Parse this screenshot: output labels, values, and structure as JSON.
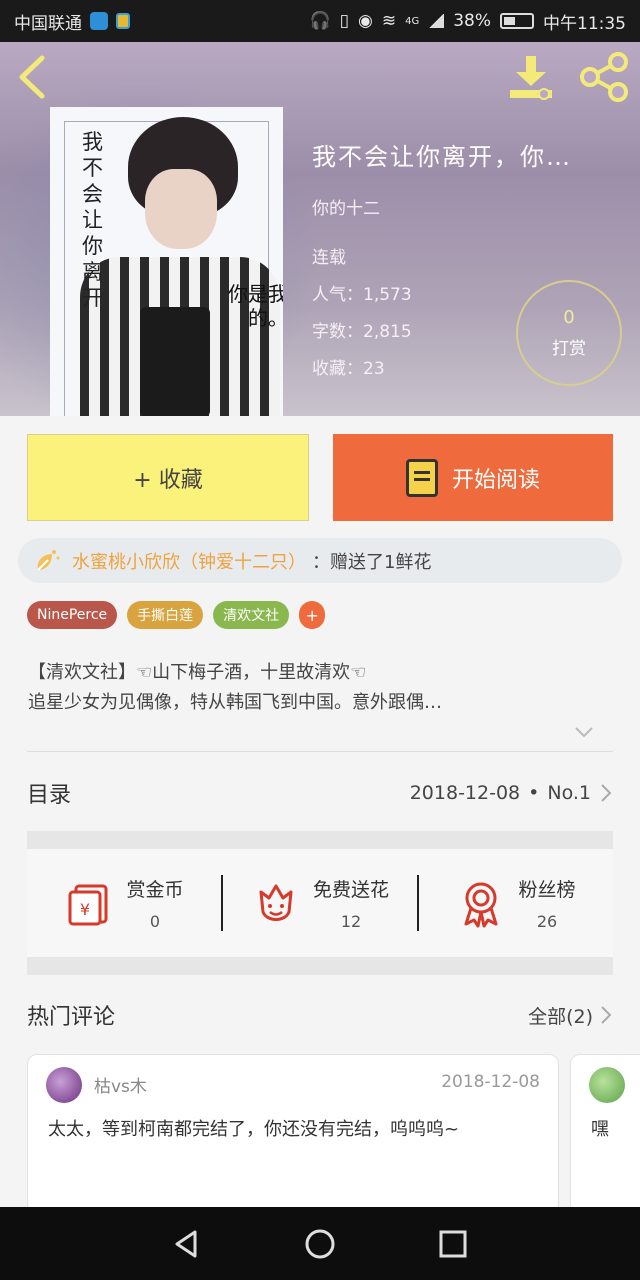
{
  "status_bar": {
    "carrier": "中国联通",
    "battery": "38%",
    "time": "中午11:35",
    "network": "4G"
  },
  "book": {
    "cover_title": "我不会让你离开",
    "cover_subtitle": "你是我的。",
    "title": "我不会让你离开，你…",
    "author": "你的十二",
    "status": "连载",
    "popularity_label": "人气：",
    "popularity": "1,573",
    "words_label": "字数：",
    "words": "2,815",
    "favorites_label": "收藏：",
    "favorites": "23"
  },
  "reward": {
    "count": "0",
    "label": "打赏"
  },
  "actions": {
    "favorite": "+ 收藏",
    "read": "开始阅读"
  },
  "gift_notice": {
    "user": "水蜜桃小欣欣（钟爱十二只）",
    "text": "：赠送了1鲜花"
  },
  "tags": [
    "NinePerce",
    "手撕白莲",
    "清欢文社",
    "+"
  ],
  "synopsis": {
    "line1": "【清欢文社】☜山下梅子酒，十里故清欢☜",
    "line2": "追星少女为见偶像，特从韩国飞到中国。意外跟偶…"
  },
  "toc": {
    "label": "目录",
    "date": "2018-12-08",
    "separator": "•",
    "chapter": "No.1"
  },
  "features": [
    {
      "label": "赏金币",
      "value": "0"
    },
    {
      "label": "免费送花",
      "value": "12"
    },
    {
      "label": "粉丝榜",
      "value": "26"
    }
  ],
  "comments": {
    "title": "热门评论",
    "all": "全部(2)",
    "items": [
      {
        "user": "枯vs木",
        "date": "2018-12-08",
        "body": "太太，等到柯南都完结了，你还没有完结，呜呜呜~"
      },
      {
        "body": "嘿"
      }
    ]
  },
  "colors": {
    "accent_orange": "#ef6a3c",
    "favorite_yellow": "#fbf27b",
    "gift_user": "#f0a23e"
  }
}
